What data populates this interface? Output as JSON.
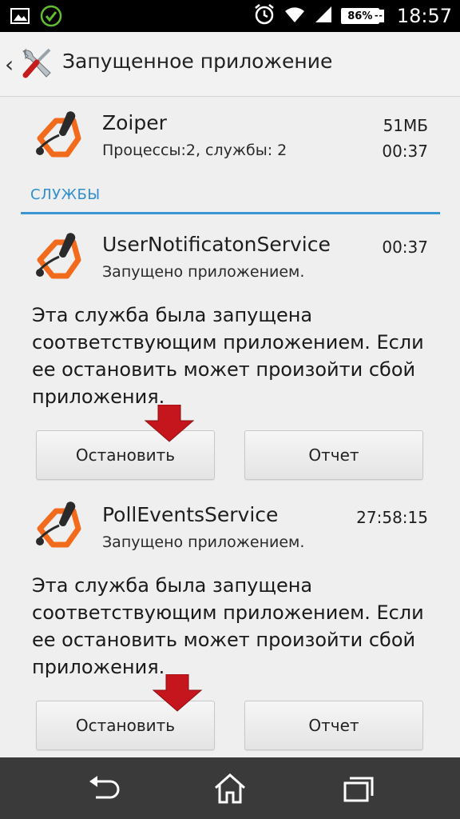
{
  "status_bar": {
    "battery_percent": "86%",
    "charging_symbol": "+",
    "time": "18:57",
    "icons": [
      "gallery-icon",
      "check-circle-icon",
      "alarm-icon",
      "wifi-icon",
      "signal-icon",
      "battery-icon"
    ]
  },
  "action_bar": {
    "back_icon": "chevron-left-icon",
    "app_icon": "tools-icon",
    "title": "Запущенное приложение"
  },
  "app": {
    "name": "Zoiper",
    "processes": "Процессы:2, службы: 2",
    "size": "51МБ",
    "time": "00:37",
    "icon": "zoiper-icon"
  },
  "section": {
    "header": "СЛУЖБЫ"
  },
  "services": [
    {
      "name": "UserNotificatonService",
      "time": "00:37",
      "status": "Запущено приложением.",
      "description": "Эта служба была запущена соответствующим приложением. Если ее остановить может произойти сбой приложения.",
      "stop_label": "Остановить",
      "report_label": "Отчет"
    },
    {
      "name": "PollEventsService",
      "time": "27:58:15",
      "status": "Запущено приложением.",
      "description": "Эта служба была запущена соответствующим приложением. Если ее остановить может произойти сбой приложения.",
      "stop_label": "Остановить",
      "report_label": "Отчет"
    }
  ],
  "nav_bar": {
    "icons": [
      "back-icon",
      "home-icon",
      "recents-icon"
    ]
  },
  "colors": {
    "accent": "#3a96d3",
    "zoiper_orange": "#f26b1d",
    "annotation_arrow": "#c4161c"
  }
}
